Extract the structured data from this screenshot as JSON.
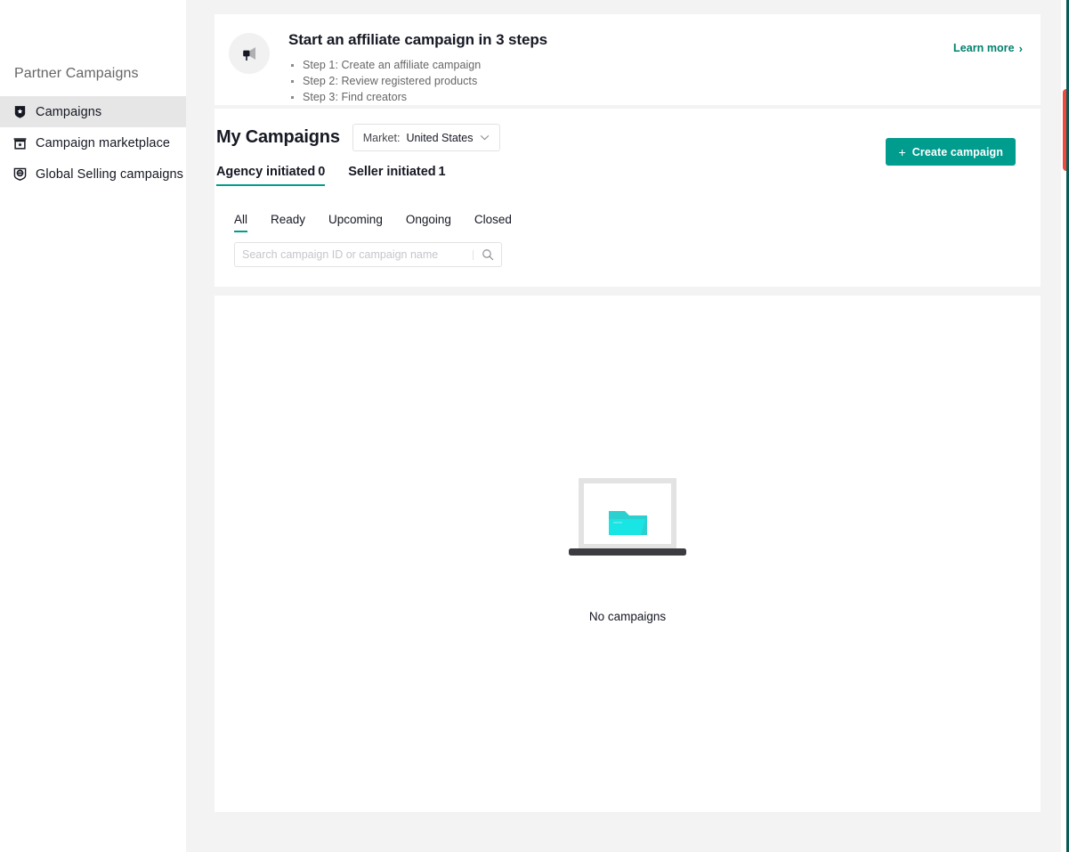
{
  "sidebar": {
    "title": "Partner Campaigns",
    "items": [
      {
        "label": "Campaigns",
        "icon": "shield-star-icon",
        "active": true
      },
      {
        "label": "Campaign marketplace",
        "icon": "storefront-icon",
        "active": false
      },
      {
        "label": "Global Selling campaigns",
        "icon": "globe-shield-icon",
        "active": false
      }
    ]
  },
  "banner": {
    "icon": "megaphone-icon",
    "title": "Start an affiliate campaign in 3 steps",
    "steps": [
      "Step 1: Create an affiliate campaign",
      "Step 2: Review registered products",
      "Step 3: Find creators"
    ],
    "learn_more": "Learn more",
    "learn_more_chevron": "›"
  },
  "campaigns": {
    "page_title": "My Campaigns",
    "market": {
      "label": "Market:",
      "value": "United States",
      "chevron": "⌄"
    },
    "create_button": {
      "plus": "+",
      "label": "Create campaign"
    },
    "initiator_tabs": [
      {
        "label": "Agency initiated",
        "count": "0",
        "active": true
      },
      {
        "label": "Seller initiated",
        "count": "1",
        "active": false
      }
    ],
    "status_tabs": [
      {
        "label": "All",
        "active": true
      },
      {
        "label": "Ready",
        "active": false
      },
      {
        "label": "Upcoming",
        "active": false
      },
      {
        "label": "Ongoing",
        "active": false
      },
      {
        "label": "Closed",
        "active": false
      }
    ],
    "search": {
      "placeholder": "Search campaign ID or campaign name",
      "value": "",
      "icon": "search-icon"
    }
  },
  "empty_state": {
    "illustration": "laptop-folder-illustration",
    "text": "No campaigns"
  },
  "colors": {
    "accent_teal": "#009c8e",
    "link_teal": "#00806f",
    "highlight_red": "#f5483b",
    "folder_cyan": "#1ae5e5",
    "folder_cyan_dark": "#2bd0cf",
    "page_bg": "#f3f3f4",
    "sidebar_active_bg": "#e6e6e6"
  }
}
